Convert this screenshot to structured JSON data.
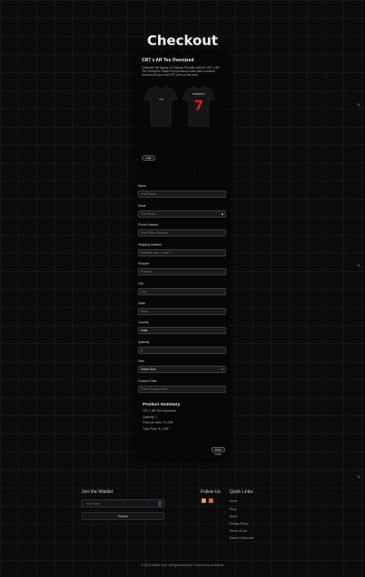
{
  "page": {
    "title": "Checkout"
  },
  "product": {
    "name": "CR7 x AR Tee Oversized",
    "description": "Celebrate the legacy of Cristiano Ronaldo with the CR7 x AR Tee Oversized. Made from premium cotton with a relaxed oversized fit and bold CR7 print on the back.",
    "shirt_text": "RONALDO",
    "shirt_number": "7",
    "add_label": "Add"
  },
  "form": {
    "fields": [
      {
        "label": "Name",
        "placeholder": "Your Name",
        "value": ""
      },
      {
        "label": "Email",
        "placeholder": "Your Email",
        "value": ""
      },
      {
        "label": "Phone Number",
        "placeholder": "Your Phone Number",
        "value": ""
      },
      {
        "label": "Shipping Address",
        "placeholder": "Address Line 1, Line 2",
        "value": ""
      },
      {
        "label": "Pincode",
        "placeholder": "Pincode",
        "value": ""
      },
      {
        "label": "City",
        "placeholder": "City",
        "value": ""
      },
      {
        "label": "State",
        "placeholder": "State",
        "value": ""
      },
      {
        "label": "Country",
        "placeholder": "",
        "value": "India"
      },
      {
        "label": "Quantity",
        "placeholder": "",
        "value": "1"
      },
      {
        "label": "Size",
        "placeholder": "",
        "value": "Select Size"
      },
      {
        "label": "Coupon Code",
        "placeholder": "Enter Coupon Code",
        "value": ""
      }
    ],
    "place_order_label": "Place Order"
  },
  "summary": {
    "title": "Product Summary",
    "lines": [
      "CR7 x AR Tee Oversized",
      "Quantity: 1",
      "Price per item: ₹ 1,299",
      "Total Price: ₹ 1,299"
    ]
  },
  "footer": {
    "wallet_title": "Join the Waitlist",
    "wallet_placeholder": "Your Email",
    "submit_label": "Submit",
    "follow_title": "Follow Us",
    "quick_title": "Quick Links",
    "quick_links": [
      "Home",
      "Shop",
      "About",
      "Privacy Policy",
      "Terms of Use",
      "Return & Refunds"
    ],
    "copyright": "© 2024 Wallet Drop. All rights reserved. Powered by worldwide"
  },
  "colors": {
    "background": "#0b0b0d",
    "card": "#070708",
    "input": "#1a1a1e",
    "shirt_number": "#c8202a"
  }
}
